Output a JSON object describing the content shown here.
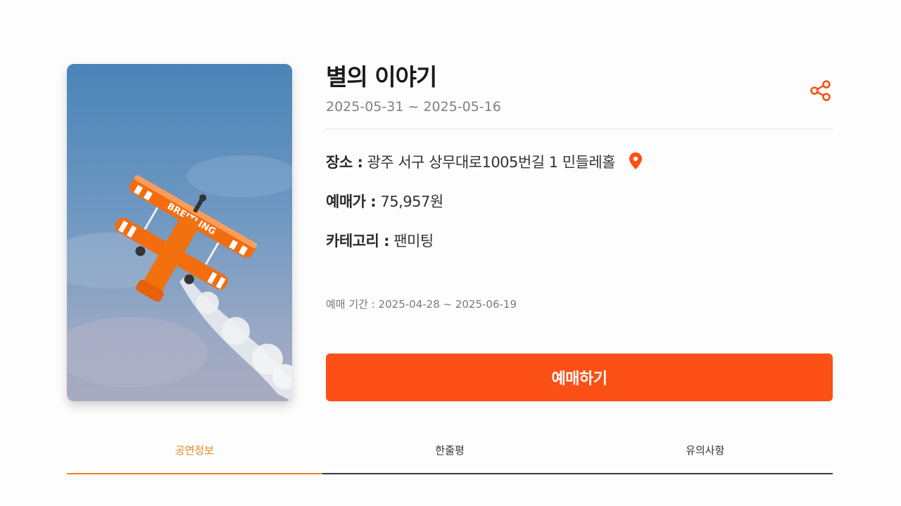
{
  "show": {
    "title": "별의 이야기",
    "dates": "2025-05-31 ~ 2025-05-16"
  },
  "details": {
    "venue_label": "장소 :",
    "venue_value": "광주 서구 상무대로1005번길 1  민들레홀",
    "price_label": "예매가 :",
    "price_value": "75,957원",
    "category_label": "카테고리 :",
    "category_value": "팬미팅",
    "sale_period": "예매 기간 : 2025-04-28 ~ 2025-06-19"
  },
  "actions": {
    "book_label": "예매하기"
  },
  "tabs": [
    {
      "label": "공연정보",
      "active": true
    },
    {
      "label": "한줄평",
      "active": false
    },
    {
      "label": "유의사항",
      "active": false
    }
  ],
  "icons": {
    "share": "share-icon",
    "location": "map-pin-icon"
  },
  "colors": {
    "accent": "#fc5016",
    "tab_active": "#f0841c"
  }
}
